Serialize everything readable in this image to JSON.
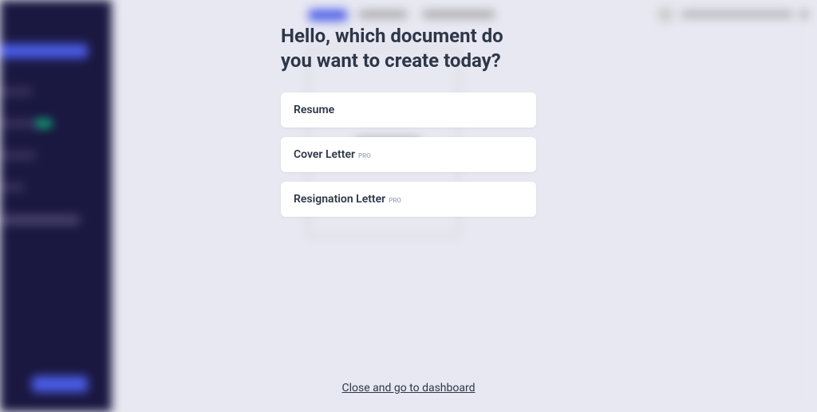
{
  "modal": {
    "title": "Hello, which document do you want to create today?",
    "options": [
      {
        "label": "Resume",
        "pro": ""
      },
      {
        "label": "Cover Letter",
        "pro": "PRO"
      },
      {
        "label": "Resignation Letter",
        "pro": "PRO"
      }
    ],
    "close": "Close and go to dashboard"
  }
}
